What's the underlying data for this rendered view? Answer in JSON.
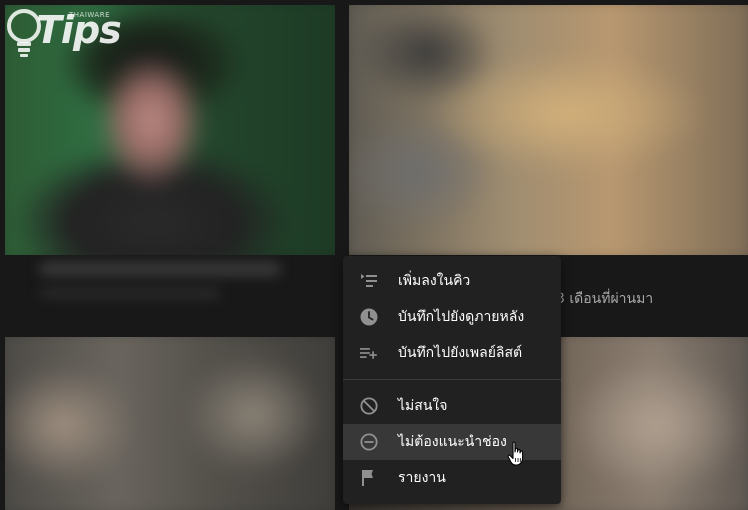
{
  "watermark": {
    "brand": "Tips",
    "tagline": "THAIWARE"
  },
  "video_meta": {
    "upload_age": "3 เดือนที่ผ่านมา"
  },
  "context_menu": {
    "items": [
      {
        "label": "เพิ่มลงในคิว",
        "icon": "add-to-queue-icon"
      },
      {
        "label": "บันทึกไปยังดูภายหลัง",
        "icon": "clock-icon"
      },
      {
        "label": "บันทึกไปยังเพลย์ลิสต์",
        "icon": "playlist-add-icon"
      },
      {
        "label": "ไม่สนใจ",
        "icon": "block-icon"
      },
      {
        "label": "ไม่ต้องแนะนำช่อง",
        "icon": "minus-circle-icon",
        "highlighted": true
      },
      {
        "label": "รายงาน",
        "icon": "flag-icon"
      }
    ]
  },
  "colors": {
    "page_background": "#181818",
    "menu_background": "#212121",
    "menu_hover": "#383838",
    "menu_text": "#ffffff",
    "icon_color": "#909090"
  }
}
